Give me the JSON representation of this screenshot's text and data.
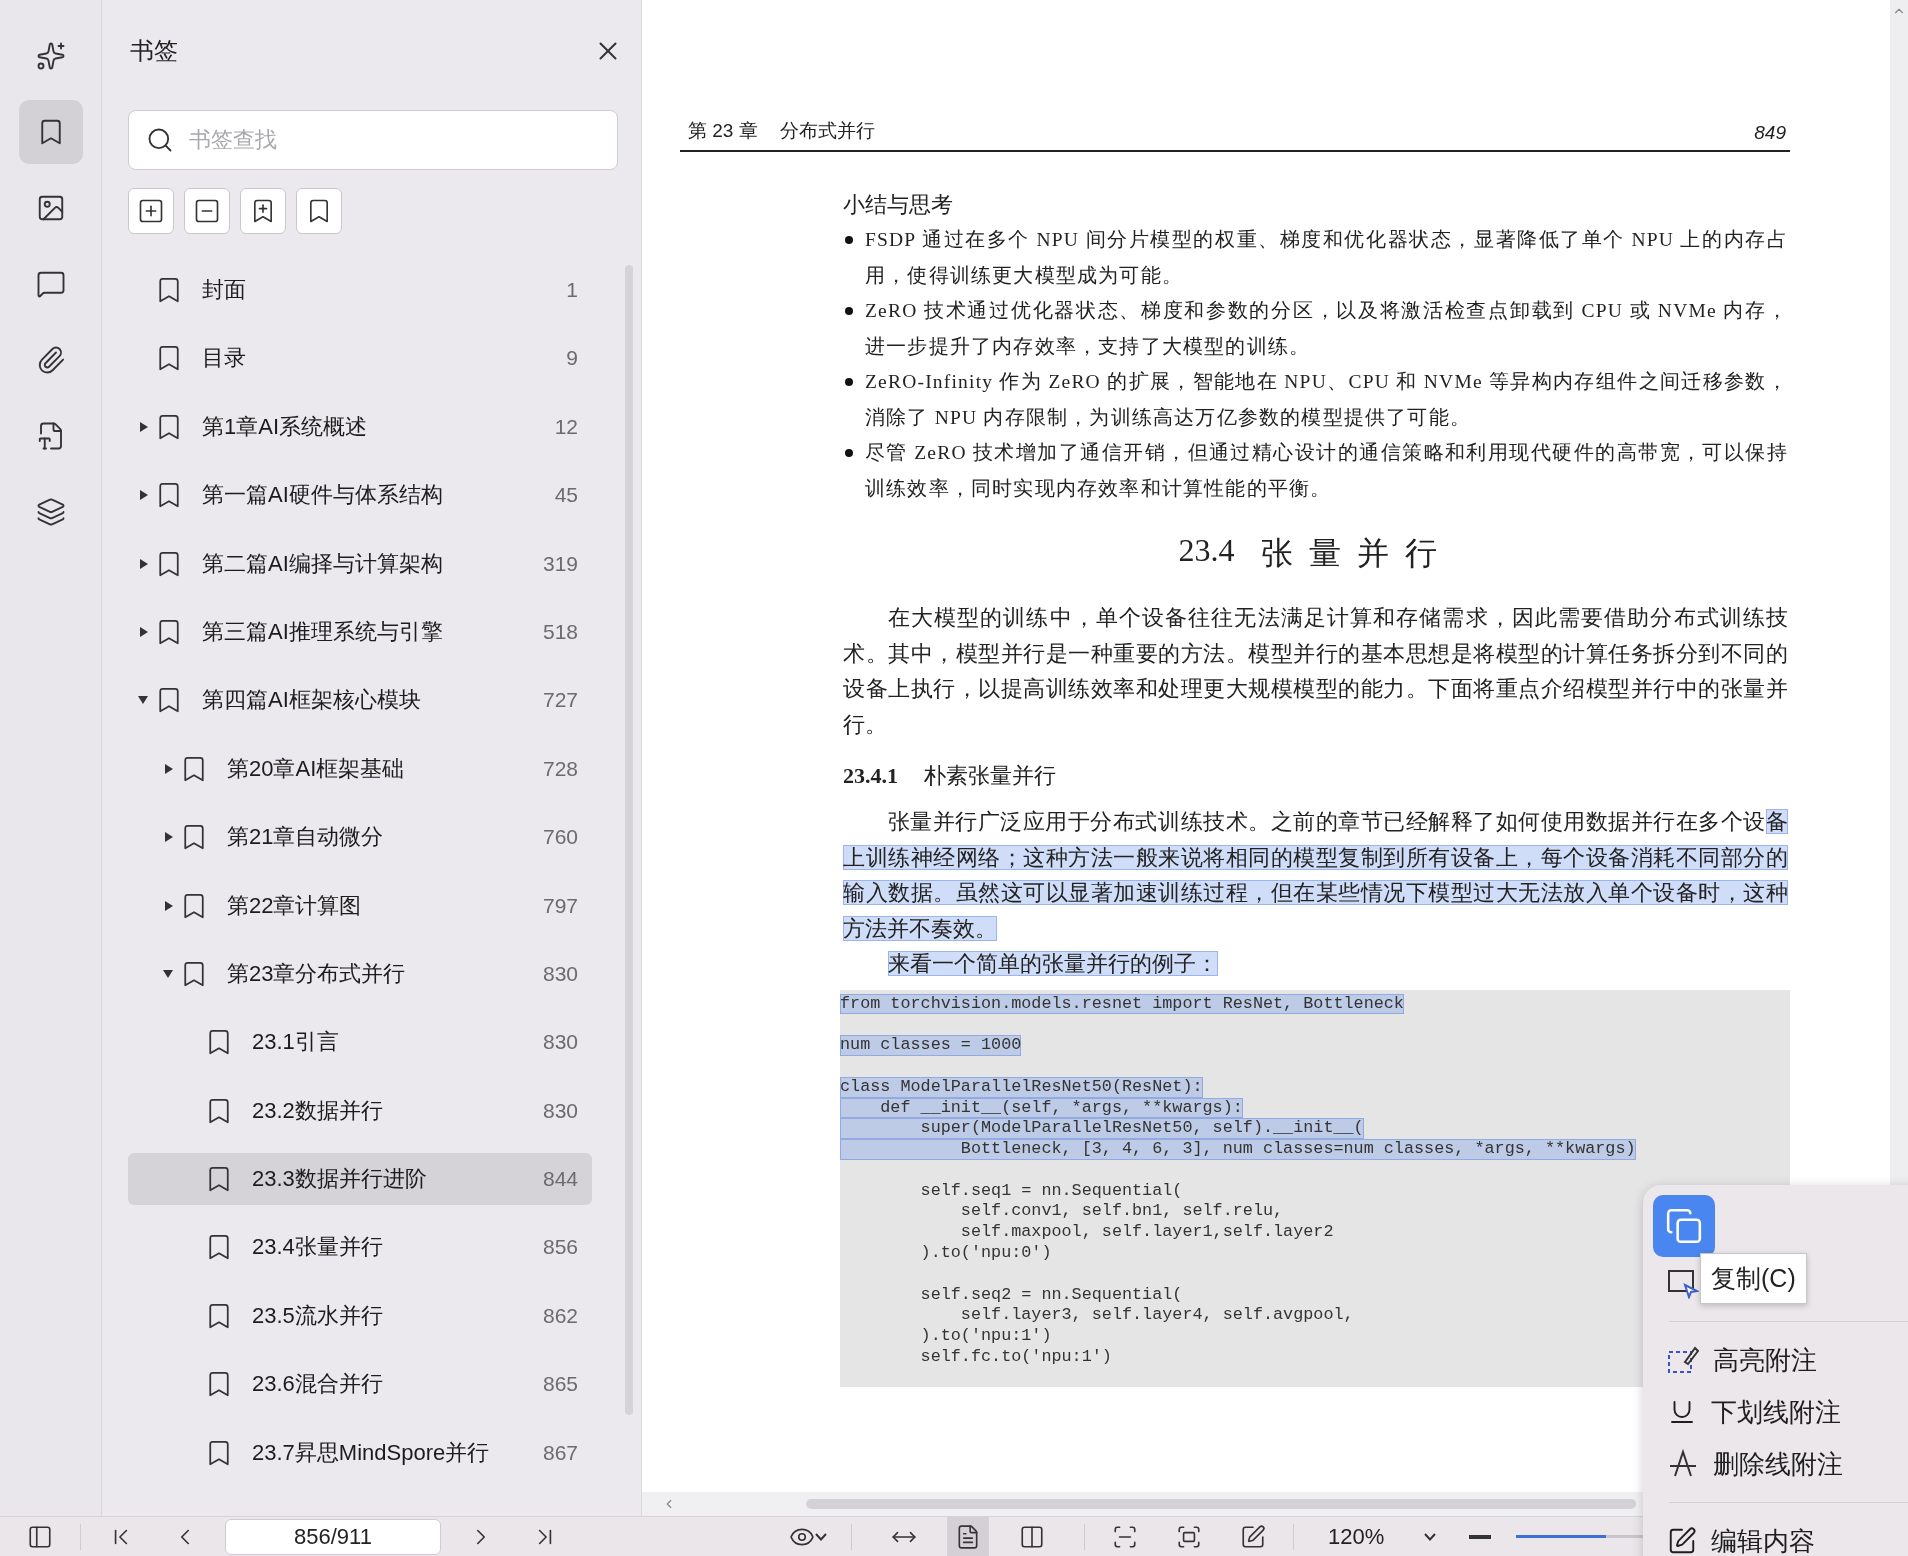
{
  "rail": [
    {
      "kind": "ai-tools",
      "selected": false
    },
    {
      "kind": "bookmarks",
      "selected": true
    },
    {
      "kind": "images",
      "selected": false
    },
    {
      "kind": "comments",
      "selected": false
    },
    {
      "kind": "attachments",
      "selected": false
    },
    {
      "kind": "convert",
      "selected": false
    },
    {
      "kind": "layers",
      "selected": false
    }
  ],
  "sidebar": {
    "title": "书签",
    "search": {
      "placeholder": "书签查找"
    },
    "tools": [
      {
        "kind": "expand-all"
      },
      {
        "kind": "collapse-all"
      },
      {
        "kind": "add"
      },
      {
        "kind": "bookmark"
      }
    ],
    "items": [
      {
        "label": "封面",
        "page": "1",
        "selected": false
      },
      {
        "label": "目录",
        "page": "9",
        "selected": false
      },
      {
        "label": "第1章AI系统概述",
        "page": "12",
        "selected": false,
        "expanded": false
      },
      {
        "label": "第一篇AI硬件与体系结构",
        "page": "45",
        "selected": false,
        "expanded": false
      },
      {
        "label": "第二篇AI编择与计算架构",
        "page": "319",
        "selected": false,
        "expanded": false
      },
      {
        "label": "第三篇AI推理系统与引擎",
        "page": "518",
        "selected": false,
        "expanded": false
      },
      {
        "label": "第四篇AI框架核心模块",
        "page": "727",
        "selected": false,
        "expanded": true,
        "children": [
          {
            "label": "第20章AI框架基础",
            "page": "728",
            "selected": false,
            "expanded": false
          },
          {
            "label": "第21章自动微分",
            "page": "760",
            "selected": false,
            "expanded": false
          },
          {
            "label": "第22章计算图",
            "page": "797",
            "selected": false,
            "expanded": false
          },
          {
            "label": "第23章分布式并行",
            "page": "830",
            "selected": false,
            "expanded": true,
            "children": [
              {
                "label": "23.1引言",
                "page": "830",
                "selected": false
              },
              {
                "label": "23.2数据并行",
                "page": "830",
                "selected": false
              },
              {
                "label": "23.3数据并行进阶",
                "page": "844",
                "selected": true
              },
              {
                "label": "23.4张量并行",
                "page": "856",
                "selected": false
              },
              {
                "label": "23.5流水并行",
                "page": "862",
                "selected": false
              },
              {
                "label": "23.6混合并行",
                "page": "865",
                "selected": false
              },
              {
                "label": "23.7昇思MindSpore并行",
                "page": "867",
                "selected": false
              }
            ]
          }
        ]
      }
    ]
  },
  "page": {
    "header": {
      "chapter": "第 23 章",
      "title": "分布式并行",
      "page_number": "849"
    },
    "summary_title": "小结与思考",
    "bullets": [
      "FSDP 通过在多个 NPU 间分片模型的权重、梯度和优化器状态，显著降低了单个 NPU 上的内存占用，使得训练更大模型成为可能。",
      "ZeRO 技术通过优化器状态、梯度和参数的分区，以及将激活检查点卸载到 CPU 或 NVMe 内存，进一步提升了内存效率，支持了大模型的训练。",
      "ZeRO-Infinity 作为 ZeRO 的扩展，智能地在 NPU、CPU 和 NVMe 等异构内存组件之间迁移参数，消除了 NPU 内存限制，为训练高达万亿参数的模型提供了可能。",
      "尽管 ZeRO 技术增加了通信开销，但通过精心设计的通信策略和利用现代硬件的高带宽，可以保持训练效率，同时实现内存效率和计算性能的平衡。"
    ],
    "section": {
      "number": "23.4",
      "title": "张量并行"
    },
    "intro": "在大模型的训练中，单个设备往往无法满足计算和存储需求，因此需要借助分布式训练技术。其中，模型并行是一种重要的方法。模型并行的基本思想是将模型的计算任务拆分到不同的设备上执行，以提高训练效率和处理更大规模模型的能力。下面将重点介绍模型并行中的张量并行。",
    "subsection": {
      "number": "23.4.1",
      "title": "朴素张量并行"
    },
    "paragraphs": [
      {
        "segments": [
          {
            "text": "张量并行广泛应用于分布式训练技术。之前的章节已经解释了如何使用数据并行在多个设",
            "selected": false
          },
          {
            "text": "备上训练神经网络；这种方法一般来说将相同的模型复制到所有设备上，每个设备消耗不同部分的输入数据。虽然这可以显著加速训练过程，但在某些情况下模型过大无法放入单个设备时，这种方法并不奏效。",
            "selected": true
          }
        ]
      },
      {
        "segments": [
          {
            "text": "来看一个简单的张量并行的例子：",
            "selected": true
          }
        ]
      }
    ],
    "code": [
      [
        {
          "text": "from torchvision.models.resnet import ResNet, Bottleneck",
          "selected": true
        }
      ],
      [
        {
          "text": "num classes = 1000",
          "selected": true
        }
      ],
      [
        {
          "text": "class ModelParallelResNet50(ResNet):",
          "selected": true
        },
        {
          "text": "    def __init__(self, *args, **kwargs):",
          "selected": true
        },
        {
          "text": "        super(ModelParallelResNet50, self).__init__(",
          "selected": true
        },
        {
          "text": "            Bottleneck, [3, 4, 6, 3], num classes=num classes, *args, **kwargs)",
          "selected": true
        }
      ],
      [
        {
          "text": "        self.seq1 = nn.Sequential(",
          "selected": false
        },
        {
          "text": "            self.conv1, self.bn1, self.relu,",
          "selected": false
        },
        {
          "text": "            self.maxpool, self.layer1,self.layer2",
          "selected": false
        },
        {
          "text": "        ).to('npu:0')",
          "selected": false
        }
      ],
      [
        {
          "text": "        self.seq2 = nn.Sequential(",
          "selected": false
        },
        {
          "text": "            self.layer3, self.layer4, self.avgpool,",
          "selected": false
        },
        {
          "text": "        ).to('npu:1')",
          "selected": false
        },
        {
          "text": "        self.fc.to('npu:1')",
          "selected": false
        }
      ]
    ]
  },
  "context_menu": {
    "tooltip": "复制(C)",
    "items": [
      {
        "kind": "copy"
      },
      {
        "kind": "select"
      },
      {
        "kind": "divider"
      },
      {
        "kind": "highlight",
        "label": "高亮附注"
      },
      {
        "kind": "underline",
        "label": "下划线附注"
      },
      {
        "kind": "strikethrough",
        "label": "删除线附注"
      },
      {
        "kind": "divider"
      },
      {
        "kind": "edit",
        "label": "编辑内容"
      }
    ]
  },
  "toolbar": {
    "page_field": "856/911",
    "view_modes": [
      {
        "kind": "fit-width",
        "selected": false
      },
      {
        "kind": "single",
        "selected": true
      },
      {
        "kind": "double",
        "selected": false
      }
    ],
    "zoom": "120%",
    "zoom_slider": {
      "level": 0.5
    }
  }
}
